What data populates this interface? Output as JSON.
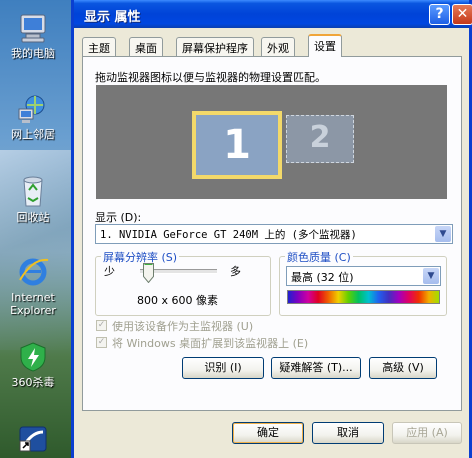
{
  "desktop": {
    "icons": [
      {
        "label": "我的电脑",
        "icon": "my-computer-icon"
      },
      {
        "label": "网上邻居",
        "icon": "network-places-icon"
      },
      {
        "label": "回收站",
        "icon": "recycle-bin-icon"
      },
      {
        "label": "Internet Explorer",
        "icon": "internet-explorer-icon"
      },
      {
        "label": "360杀毒",
        "icon": "antivirus-shield-icon"
      }
    ]
  },
  "window": {
    "title": "显示 属性",
    "help_glyph": "?",
    "close_glyph": "✕"
  },
  "tabs": [
    {
      "label": "主题",
      "active": false
    },
    {
      "label": "桌面",
      "active": false
    },
    {
      "label": "屏幕保护程序",
      "active": false
    },
    {
      "label": "外观",
      "active": false
    },
    {
      "label": "设置",
      "active": true
    }
  ],
  "settings": {
    "instruction": "拖动监视器图标以便与监视器的物理设置匹配。",
    "monitors": [
      {
        "number": "1",
        "selected": true
      },
      {
        "number": "2",
        "selected": false
      }
    ],
    "display_label": "显示 (D):",
    "display_value": "1. NVIDIA GeForce GT 240M  上的 (多个监视器)",
    "resolution": {
      "group_label": "屏幕分辨率 (S)",
      "less_label": "少",
      "more_label": "多",
      "value": "800 x 600 像素",
      "slider_position": 0.05
    },
    "color_quality": {
      "group_label": "颜色质量 (C)",
      "value": "最高 (32 位)"
    },
    "checkbox_primary": "使用该设备作为主监视器 (U)",
    "checkbox_extend": "将 Windows 桌面扩展到该监视器上 (E)",
    "identify_button": "识别 (I)",
    "troubleshoot_button": "疑难解答 (T)...",
    "advanced_button": "高级 (V)"
  },
  "footer": {
    "ok_button": "确定",
    "cancel_button": "取消",
    "apply_button": "应用 (A)"
  },
  "colors": {
    "titlebar_blue": "#0043d8",
    "dialog_face": "#ece9d8",
    "monitor_selected_border": "#f3d96a",
    "group_label_blue": "#1f4fc4"
  }
}
